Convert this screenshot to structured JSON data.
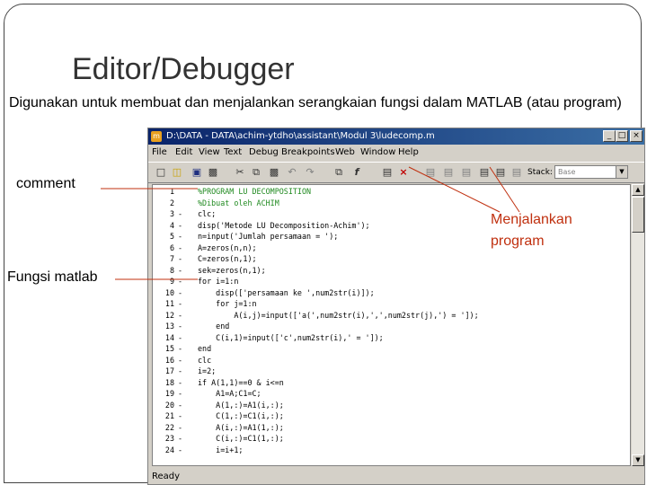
{
  "slide": {
    "title": "Editor/Debugger",
    "description": "Digunakan untuk membuat dan menjalankan serangkaian fungsi dalam MATLAB (atau program)",
    "callouts": {
      "comment": "comment",
      "fungsi": "Fungsi matlab",
      "run": "Menjalankan program"
    },
    "callout_line_color": "#c0300f"
  },
  "window": {
    "title": "D:\\DATA - DATA\\achim-ytdho\\assistant\\Modul 3\\ludecomp.m",
    "menu": [
      "File",
      "Edit",
      "View",
      "Text",
      "Debug",
      "Breakpoints",
      "Web",
      "Window",
      "Help"
    ],
    "stack_label": "Stack:",
    "stack_value": "Base",
    "status": "Ready",
    "colors": {
      "title_start": "#0a246a",
      "title_end": "#3a6ea5",
      "chrome": "#d4d0c8",
      "comment": "#228b22"
    }
  },
  "toolbar_icons": [
    "new-file-icon",
    "open-folder-icon",
    "save-icon",
    "print-icon",
    "cut-icon",
    "copy-icon",
    "paste-icon",
    "undo-icon",
    "redo-icon",
    "find-icon",
    "function-icon",
    "run-icon",
    "clear-breakpoints-icon",
    "step-icon",
    "step-in-icon",
    "step-out-icon",
    "continue-icon",
    "exit-debug-icon",
    "stop-icon"
  ],
  "code": [
    {
      "n": "1",
      "m": "",
      "t": "%PROGRAM LU DECOMPOSITION",
      "c": true
    },
    {
      "n": "2",
      "m": "",
      "t": "%Dibuat oleh ACHIM",
      "c": true
    },
    {
      "n": "3",
      "m": "-",
      "t": "clc;",
      "c": false
    },
    {
      "n": "4",
      "m": "-",
      "t": "disp('Metode LU Decomposition-Achim');",
      "c": false
    },
    {
      "n": "5",
      "m": "-",
      "t": "n=input('Jumlah persamaan = ');",
      "c": false
    },
    {
      "n": "6",
      "m": "-",
      "t": "A=zeros(n,n);",
      "c": false
    },
    {
      "n": "7",
      "m": "-",
      "t": "C=zeros(n,1);",
      "c": false
    },
    {
      "n": "8",
      "m": "-",
      "t": "sek=zeros(n,1);",
      "c": false
    },
    {
      "n": "9",
      "m": "-",
      "t": "for i=1:n",
      "c": false
    },
    {
      "n": "10",
      "m": "-",
      "t": "    disp(['persamaan ke ',num2str(i)]);",
      "c": false
    },
    {
      "n": "11",
      "m": "-",
      "t": "    for j=1:n",
      "c": false
    },
    {
      "n": "12",
      "m": "-",
      "t": "        A(i,j)=input(['a(',num2str(i),',',num2str(j),') = ']);",
      "c": false
    },
    {
      "n": "13",
      "m": "-",
      "t": "    end",
      "c": false
    },
    {
      "n": "14",
      "m": "-",
      "t": "    C(i,1)=input(['c',num2str(i),' = ']);",
      "c": false
    },
    {
      "n": "15",
      "m": "-",
      "t": "end",
      "c": false
    },
    {
      "n": "16",
      "m": "-",
      "t": "clc",
      "c": false
    },
    {
      "n": "17",
      "m": "-",
      "t": "i=2;",
      "c": false
    },
    {
      "n": "18",
      "m": "-",
      "t": "if A(1,1)==0 & i<=n",
      "c": false
    },
    {
      "n": "19",
      "m": "-",
      "t": "    A1=A;C1=C;",
      "c": false
    },
    {
      "n": "20",
      "m": "-",
      "t": "    A(1,:)=A1(i,:);",
      "c": false
    },
    {
      "n": "21",
      "m": "-",
      "t": "    C(1,:)=C1(i,:);",
      "c": false
    },
    {
      "n": "22",
      "m": "-",
      "t": "    A(i,:)=A1(1,:);",
      "c": false
    },
    {
      "n": "23",
      "m": "-",
      "t": "    C(i,:)=C1(1,:);",
      "c": false
    },
    {
      "n": "24",
      "m": "-",
      "t": "    i=i+1;",
      "c": false
    }
  ]
}
